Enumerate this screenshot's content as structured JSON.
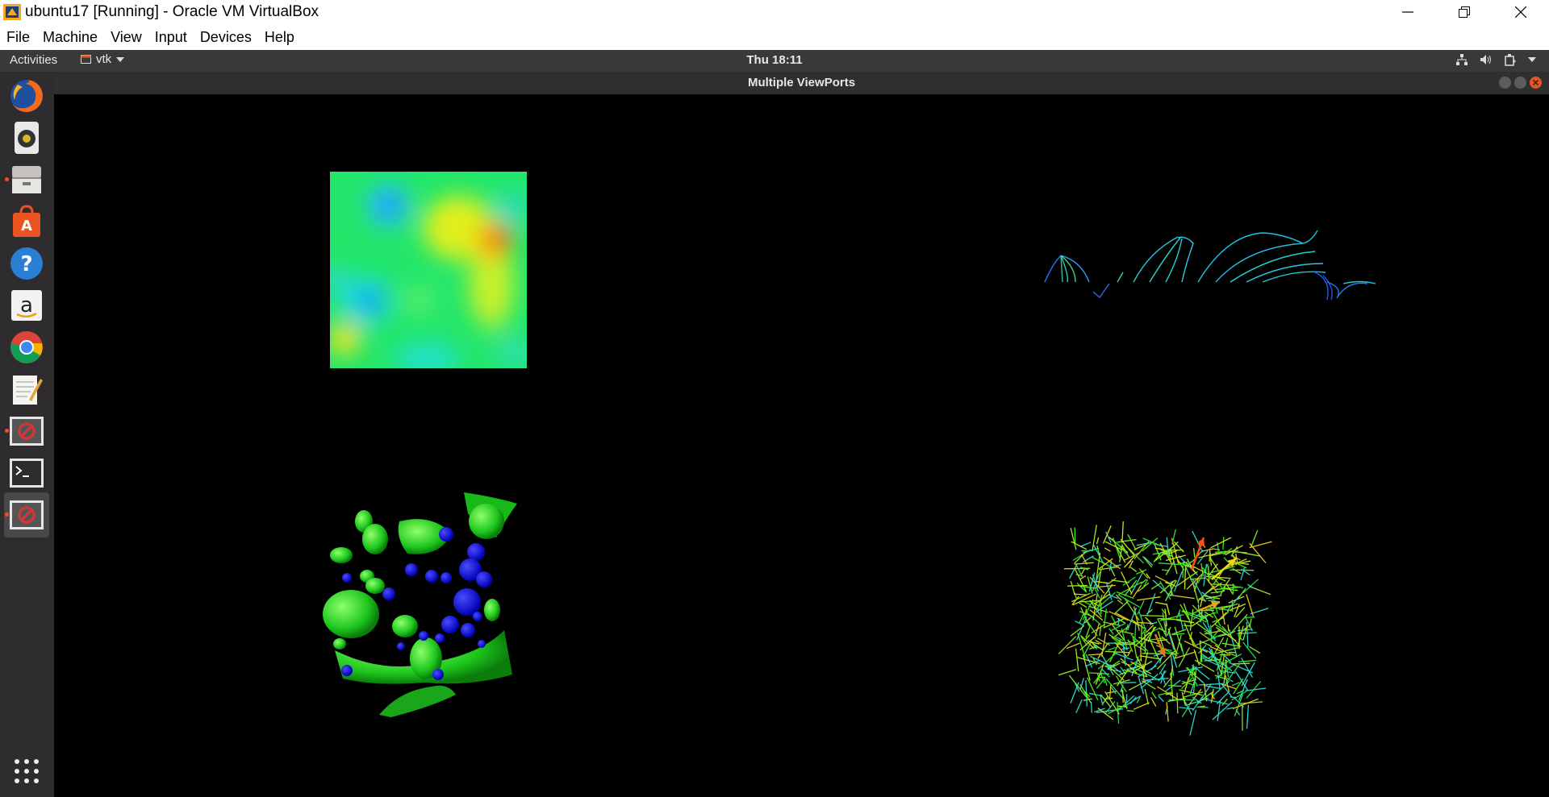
{
  "host_window": {
    "title": "ubuntu17 [Running] - Oracle VM VirtualBox",
    "controls": [
      "minimize",
      "restore",
      "close"
    ]
  },
  "vbox_menu": [
    "File",
    "Machine",
    "View",
    "Input",
    "Devices",
    "Help"
  ],
  "topbar": {
    "activities": "Activities",
    "app_name": "vtk",
    "clock": "Thu 18:11",
    "tray_icons": [
      "network-icon",
      "volume-icon",
      "power-icon",
      "chevron-down-icon"
    ]
  },
  "vtk_window": {
    "title": "Multiple ViewPorts"
  },
  "dock": {
    "items": [
      {
        "name": "firefox-icon"
      },
      {
        "name": "rhythmbox-icon"
      },
      {
        "name": "files-icon"
      },
      {
        "name": "software-icon"
      },
      {
        "name": "help-icon"
      },
      {
        "name": "amazon-icon"
      },
      {
        "name": "chrome-icon"
      },
      {
        "name": "text-editor-icon"
      },
      {
        "name": "vtk-app-icon"
      },
      {
        "name": "terminal-icon"
      },
      {
        "name": "vtk-app-icon-2"
      },
      {
        "name": "show-applications-icon"
      }
    ]
  },
  "colors": {
    "topbar": "#3a3939",
    "dock": "#2e2c2e",
    "accent": "#e95420"
  }
}
